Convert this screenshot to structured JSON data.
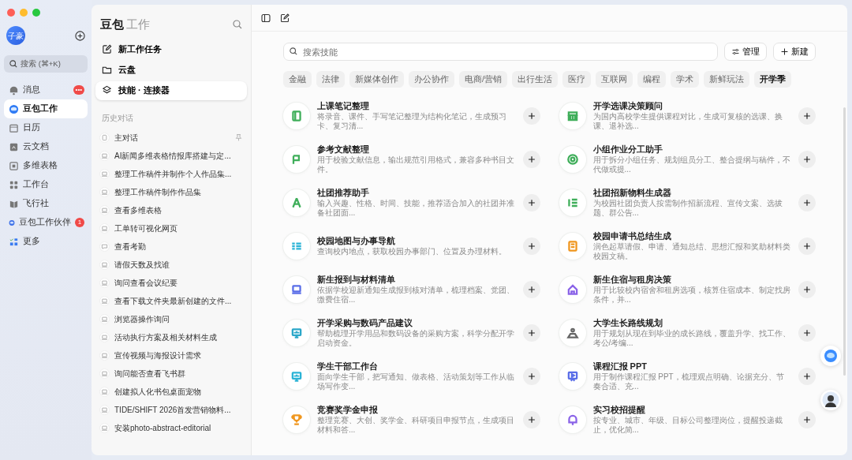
{
  "sidebar": {
    "avatar": "子豪",
    "search": {
      "placeholder": "搜索 (⌘+K)"
    },
    "items": [
      {
        "label": "消息",
        "selected": false,
        "badge": "•••"
      },
      {
        "label": "豆包工作",
        "selected": true
      },
      {
        "label": "日历",
        "selected": false
      },
      {
        "label": "云文档",
        "selected": false
      },
      {
        "label": "多维表格",
        "selected": false
      },
      {
        "label": "工作台",
        "selected": false
      },
      {
        "label": "飞行社",
        "selected": false
      },
      {
        "label": "豆包工作伙伴",
        "selected": false,
        "badge": "1"
      },
      {
        "label": "更多",
        "selected": false
      }
    ]
  },
  "panel": {
    "title": "豆包",
    "subtitle": "工作",
    "actions": [
      {
        "label": "新工作任务",
        "selected": false
      },
      {
        "label": "云盘",
        "selected": false
      },
      {
        "label": "技能 · 连接器",
        "selected": true
      }
    ],
    "history_heading": "历史对话",
    "history": [
      {
        "label": "主对话",
        "kind": "main",
        "pinned": true
      },
      {
        "label": "AI新闻多维表格情报库搭建与定...",
        "kind": "task"
      },
      {
        "label": "整理工作稿件并制作个人作品集...",
        "kind": "task"
      },
      {
        "label": "整理工作稿件制作作品集",
        "kind": "task"
      },
      {
        "label": "查看多维表格",
        "kind": "task"
      },
      {
        "label": "工单转可视化网页",
        "kind": "task"
      },
      {
        "label": "查看考勤",
        "kind": "chat"
      },
      {
        "label": "请假天数及找谁",
        "kind": "task"
      },
      {
        "label": "询问查看会议纪要",
        "kind": "task"
      },
      {
        "label": "查看下载文件夹最新创建的文件...",
        "kind": "task"
      },
      {
        "label": "浏览器操作询问",
        "kind": "task"
      },
      {
        "label": "活动执行方案及相关材料生成",
        "kind": "task"
      },
      {
        "label": "宣传视频与海报设计需求",
        "kind": "task"
      },
      {
        "label": "询问能否查看飞书群",
        "kind": "task"
      },
      {
        "label": "创建拟人化书包桌面宠物",
        "kind": "task"
      },
      {
        "label": "TIDE/SHIFT 2026首发营销物料...",
        "kind": "task"
      },
      {
        "label": "安装photo-abstract-editorial",
        "kind": "task"
      }
    ]
  },
  "main": {
    "search": {
      "placeholder": "搜索技能"
    },
    "buttons": [
      "管理",
      "新建"
    ],
    "categories": [
      {
        "label": "金融",
        "selected": false
      },
      {
        "label": "法律",
        "selected": false
      },
      {
        "label": "新媒体创作",
        "selected": false
      },
      {
        "label": "办公协作",
        "selected": false
      },
      {
        "label": "电商/营销",
        "selected": false
      },
      {
        "label": "出行生活",
        "selected": false
      },
      {
        "label": "医疗",
        "selected": false
      },
      {
        "label": "互联网",
        "selected": false
      },
      {
        "label": "编程",
        "selected": false
      },
      {
        "label": "学术",
        "selected": false
      },
      {
        "label": "新鲜玩法",
        "selected": false
      },
      {
        "label": "开学季",
        "selected": true
      }
    ],
    "skills": [
      {
        "title": "上课笔记整理",
        "description": "将录音、课件、手写笔记整理为结构化笔记，生成预习卡、复习清...",
        "color": "#3fae5a"
      },
      {
        "title": "开学选课决策顾问",
        "description": "为国内高校学生提供课程对比，生成可复核的选课、换课、退补选...",
        "color": "#3fae5a"
      },
      {
        "title": "参考文献整理",
        "description": "用于校验文献信息，输出规范引用格式，兼容多种书目文件。",
        "color": "#3fae5a"
      },
      {
        "title": "小组作业分工助手",
        "description": "用于拆分小组任务、规划组员分工、整合提纲与稿件，不代做或提...",
        "color": "#3fae5a"
      },
      {
        "title": "社团推荐助手",
        "description": "输入兴趣、性格、时间、技能，推荐适合加入的社团并准备社团面...",
        "color": "#3fae5a"
      },
      {
        "title": "社团招新物料生成器",
        "description": "为校园社团负责人按需制作招新流程、宣传文案、选拔题、群公告...",
        "color": "#3fae5a"
      },
      {
        "title": "校园地图与办事导航",
        "description": "查询校内地点，获取校园办事部门、位置及办理材料。",
        "color": "#2bb3d6"
      },
      {
        "title": "校园申请书总结生成",
        "description": "润色起草请假、申请、通知总结、思想汇报和奖助材料类校园文稿。",
        "color": "#f0961e"
      },
      {
        "title": "新生报到与材料清单",
        "description": "依据学校迎新通知生成报到核对清单，梳理档案、党团、缴费住宿...",
        "color": "#5a6ee8"
      },
      {
        "title": "新生住宿与租房决策",
        "description": "用于比较校内宿舍和租房选项，核算住宿成本、制定找房条件，并...",
        "color": "#8a63e8"
      },
      {
        "title": "开学采购与数码产品建议",
        "description": "帮助梳理开学用品和数码设备的采购方案，科学分配开学启动资金。",
        "color": "#2ba7c9"
      },
      {
        "title": "大学生长路线规划",
        "description": "用于规划从现在到毕业的成长路线，覆盖升学、找工作、考公/考编...",
        "color": "#666666"
      },
      {
        "title": "学生干部工作台",
        "description": "面向学生干部，把写通知、做表格、活动策划等工作从临场写作变...",
        "color": "#2bb3d6"
      },
      {
        "title": "课程汇报 PPT",
        "description": "用于制作课程汇报 PPT，梳理观点明确、论据充分、节奏合适、充...",
        "color": "#5a6ee8"
      },
      {
        "title": "竞赛奖学金申报",
        "description": "整理竞赛、大创、奖学金、科研项目申报节点，生成项目材料和答...",
        "color": "#f0961e"
      },
      {
        "title": "实习校招提醒",
        "description": "按专业、城市、年级、目标公司整理岗位，提醒投递截止，优化简...",
        "color": "#8a63e8"
      }
    ]
  }
}
